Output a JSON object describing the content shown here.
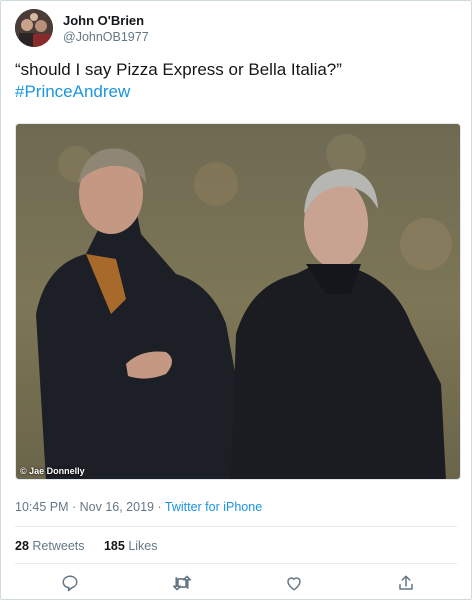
{
  "user": {
    "display_name": "John O'Brien",
    "handle": "@JohnOB1977"
  },
  "tweet": {
    "text": "“should I say Pizza Express or Bella Italia?”",
    "hashtag": "#PrinceAndrew"
  },
  "media": {
    "credit": "© Jae Donnelly"
  },
  "meta": {
    "time": "10:45 PM",
    "separator1": " · ",
    "date": "Nov 16, 2019",
    "separator2": " · ",
    "source": "Twitter for iPhone"
  },
  "stats": {
    "retweets_count": "28",
    "retweets_label": "Retweets",
    "likes_count": "185",
    "likes_label": "Likes"
  },
  "actions": {
    "icons": [
      "reply-icon",
      "retweet-icon",
      "like-icon",
      "share-icon"
    ]
  },
  "colors": {
    "accent": "#1b95e0",
    "secondary_text": "#657786",
    "primary_text": "#14171a"
  }
}
